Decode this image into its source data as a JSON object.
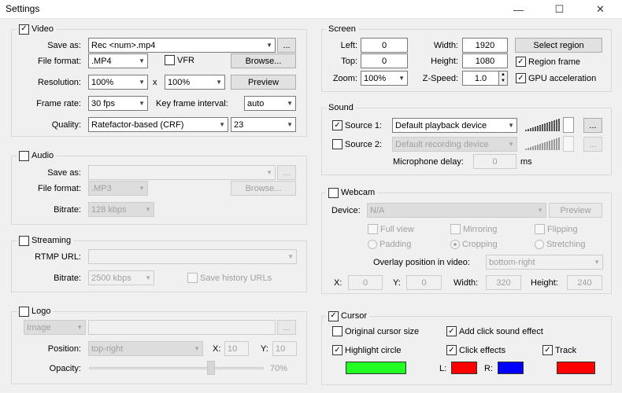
{
  "window": {
    "title": "Settings",
    "min_glyph": "—",
    "max_glyph": "☐",
    "close_glyph": "✕"
  },
  "video": {
    "title": "Video",
    "enabled": true,
    "save_as_label": "Save as:",
    "save_as_value": "Rec <num>.mp4",
    "ellipsis": "...",
    "file_format_label": "File format:",
    "file_format_value": ".MP4",
    "vfr_label": "VFR",
    "browse_label": "Browse...",
    "resolution_label": "Resolution:",
    "res_w_value": "100%",
    "res_x": "x",
    "res_h_value": "100%",
    "preview_label": "Preview",
    "frame_rate_label": "Frame rate:",
    "frame_rate_value": "30 fps",
    "keyframe_label": "Key frame interval:",
    "keyframe_value": "auto",
    "quality_label": "Quality:",
    "quality_mode_value": "Ratefactor-based (CRF)",
    "quality_value": "23"
  },
  "audio": {
    "title": "Audio",
    "enabled": false,
    "save_as_label": "Save as:",
    "ellipsis": "...",
    "file_format_label": "File format:",
    "file_format_value": ".MP3",
    "browse_label": "Browse...",
    "bitrate_label": "Bitrate:",
    "bitrate_value": "128 kbps"
  },
  "streaming": {
    "title": "Streaming",
    "enabled": false,
    "rtmp_label": "RTMP URL:",
    "bitrate_label": "Bitrate:",
    "bitrate_value": "2500 kbps",
    "save_history_label": "Save history URLs"
  },
  "logo": {
    "title": "Logo",
    "enabled": false,
    "type_value": "Image",
    "ellipsis": "...",
    "position_label": "Position:",
    "position_value": "top-right",
    "x_label": "X:",
    "x_value": "10",
    "y_label": "Y:",
    "y_value": "10",
    "opacity_label": "Opacity:",
    "opacity_value": "70%",
    "opacity_fraction": 0.7
  },
  "screen": {
    "title": "Screen",
    "left_label": "Left:",
    "left_value": "0",
    "top_label": "Top:",
    "top_value": "0",
    "zoom_label": "Zoom:",
    "zoom_value": "100%",
    "width_label": "Width:",
    "width_value": "1920",
    "height_label": "Height:",
    "height_value": "1080",
    "zspeed_label": "Z-Speed:",
    "zspeed_value": "1.0",
    "select_region_label": "Select region",
    "region_frame_label": "Region frame",
    "region_frame_checked": true,
    "gpu_label": "GPU acceleration",
    "gpu_checked": true
  },
  "sound": {
    "title": "Sound",
    "source1_label": "Source 1:",
    "source1_checked": true,
    "source1_value": "Default playback device",
    "source2_label": "Source 2:",
    "source2_checked": false,
    "source2_value": "Default recording device",
    "ellipsis": "...",
    "mic_delay_label": "Microphone delay:",
    "mic_delay_value": "0",
    "mic_delay_unit": "ms"
  },
  "webcam": {
    "title": "Webcam",
    "enabled": false,
    "device_label": "Device:",
    "device_value": "N/A",
    "preview_label": "Preview",
    "full_view_label": "Full view",
    "mirroring_label": "Mirroring",
    "flipping_label": "Flipping",
    "padding_label": "Padding",
    "cropping_label": "Cropping",
    "stretching_label": "Stretching",
    "overlay_label": "Overlay position in video:",
    "overlay_value": "bottom-right",
    "x_label": "X:",
    "x_value": "0",
    "y_label": "Y:",
    "y_value": "0",
    "width_label": "Width:",
    "width_value": "320",
    "height_label": "Height:",
    "height_value": "240"
  },
  "cursor": {
    "title": "Cursor",
    "enabled": true,
    "original_size_label": "Original cursor size",
    "original_size_checked": false,
    "click_sound_label": "Add click sound effect",
    "click_sound_checked": true,
    "highlight_label": "Highlight circle",
    "highlight_checked": true,
    "click_effects_label": "Click effects",
    "click_effects_checked": true,
    "track_label": "Track",
    "track_checked": true,
    "l_label": "L:",
    "r_label": "R:",
    "highlight_color": "#22ff22",
    "left_click_color": "#ff0000",
    "right_click_color": "#0000ff",
    "track_color": "#ff0000"
  },
  "colors": {
    "check_glyph": "✓"
  }
}
